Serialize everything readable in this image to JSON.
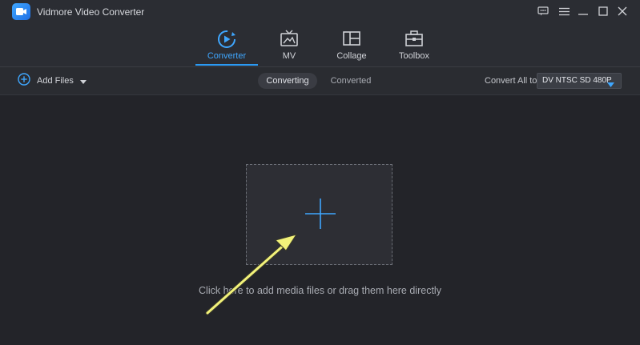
{
  "app": {
    "title": "Vidmore Video Converter"
  },
  "window_controls": [
    {
      "name": "feedback-icon"
    },
    {
      "name": "menu-icon"
    },
    {
      "name": "minimize-icon"
    },
    {
      "name": "maximize-icon"
    },
    {
      "name": "close-icon"
    }
  ],
  "nav": {
    "tabs": [
      {
        "label": "Converter",
        "icon": "converter-icon",
        "active": true
      },
      {
        "label": "MV",
        "icon": "mv-icon",
        "active": false
      },
      {
        "label": "Collage",
        "icon": "collage-icon",
        "active": false
      },
      {
        "label": "Toolbox",
        "icon": "toolbox-icon",
        "active": false
      }
    ]
  },
  "toolbar": {
    "add_files_label": "Add Files",
    "subtabs": {
      "converting": "Converting",
      "converted": "Converted"
    },
    "convert_all_label": "Convert All to:",
    "format_value": "DV NTSC SD 480P"
  },
  "main": {
    "hint": "Click here to add media files or drag them here directly"
  },
  "colors": {
    "accent": "#2b9af3",
    "background": "#232429",
    "annotation_arrow": "#f2f27a"
  }
}
